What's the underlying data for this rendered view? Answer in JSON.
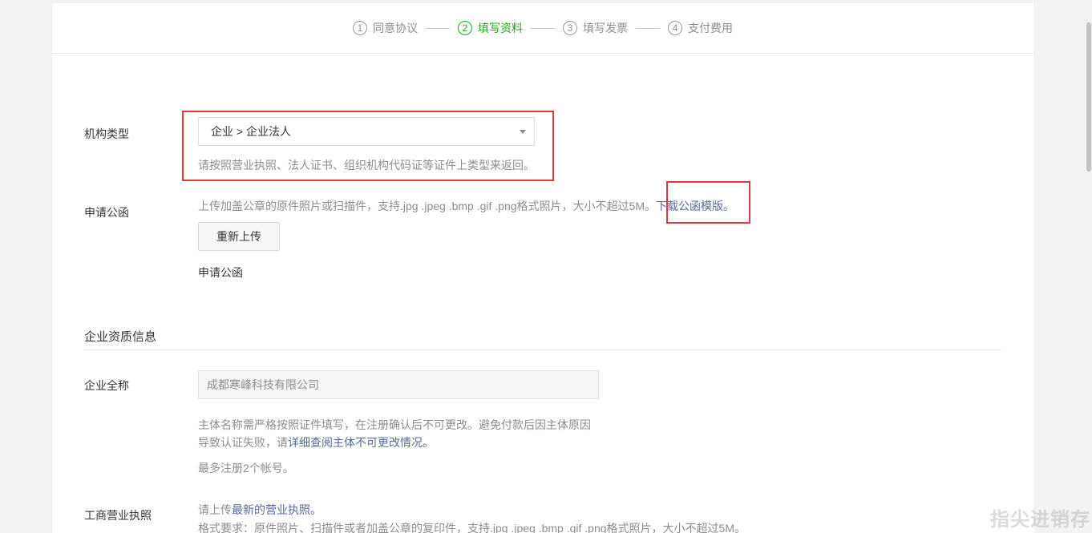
{
  "steps": [
    {
      "num": "1",
      "label": "同意协议",
      "active": false
    },
    {
      "num": "2",
      "label": "填写资料",
      "active": true
    },
    {
      "num": "3",
      "label": "填写发票",
      "active": false
    },
    {
      "num": "4",
      "label": "支付费用",
      "active": false
    }
  ],
  "org_type": {
    "label": "机构类型",
    "selected": "企业 > 企业法人",
    "hint": "请按照营业执照、法人证书、组织机构代码证等证件上类型来返回。"
  },
  "letter": {
    "label": "申请公函",
    "hint": "上传加盖公章的原件照片或扫描件，支持.jpg .jpeg .bmp .gif .png格式照片，大小不超过5M。",
    "download_link": "下载公函模版。",
    "upload_button": "重新上传",
    "file_name": "申请公函"
  },
  "company_section": {
    "title": "企业资质信息",
    "name_label": "企业全称",
    "name_value": "成都寒峰科技有限公司",
    "name_hint_line1": "主体名称需严格按照证件填写，在注册确认后不可更改。避免付款后因主体原因",
    "name_hint_line2_prefix": "导致认证失败，请",
    "name_hint_link": "详细查阅主体不可更改情况。",
    "name_limit": "最多注册2个帐号。",
    "license_label": "工商营业执照",
    "license_hint_prefix": "请上传",
    "license_hint_link": "最新的营业执照。",
    "license_format": "格式要求：原件照片、扫描件或者加盖公章的复印件，支持.jpg .jpeg .bmp .gif .png格式照片，大小不超过5M。"
  },
  "watermark": "指尖进销存",
  "colors": {
    "accent": "#1aad19",
    "link": "#576b95",
    "annotation": "#e3393c"
  }
}
